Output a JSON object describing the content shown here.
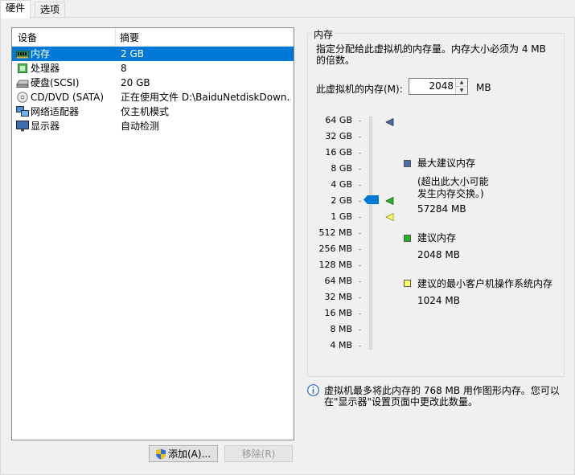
{
  "tabs": {
    "hardware": "硬件",
    "options": "选项"
  },
  "device_list": {
    "col_device": "设备",
    "col_summary": "摘要",
    "rows": [
      {
        "icon": "memory-icon",
        "name": "内存",
        "summary": "2 GB"
      },
      {
        "icon": "processor-icon",
        "name": "处理器",
        "summary": "8"
      },
      {
        "icon": "hard-disk-icon",
        "name": "硬盘(SCSI)",
        "summary": "20 GB"
      },
      {
        "icon": "cd-dvd-icon",
        "name": "CD/DVD (SATA)",
        "summary": "正在使用文件 D:\\BaiduNetdiskDown..."
      },
      {
        "icon": "network-adapter-icon",
        "name": "网络适配器",
        "summary": "仅主机模式"
      },
      {
        "icon": "display-icon",
        "name": "显示器",
        "summary": "自动检测"
      }
    ],
    "selected_index": 0
  },
  "buttons": {
    "add": "添加(A)...",
    "remove": "移除(R)"
  },
  "memory": {
    "group_title": "内存",
    "description": "指定分配给此虚拟机的内存量。内存大小必须为 4 MB 的倍数。",
    "field_label": "此虚拟机的内存(M):",
    "value": "2048",
    "unit": "MB",
    "scale": [
      "64 GB",
      "32 GB",
      "16 GB",
      "8 GB",
      "4 GB",
      "2 GB",
      "1 GB",
      "512 MB",
      "256 MB",
      "128 MB",
      "64 MB",
      "32 MB",
      "16 MB",
      "8 MB",
      "4 MB"
    ],
    "current_value_mb": 2048,
    "legend": {
      "max_title": "最大建议内存",
      "max_note": "(超出此大小可能\n发生内存交换。)",
      "max_value": "57284 MB",
      "recommended_title": "建议内存",
      "recommended_value": "2048 MB",
      "min_title": "建议的最小客户机操作系统内存",
      "min_value": "1024 MB"
    },
    "colors": {
      "max": "#4a6ea9",
      "recommended": "#23b523",
      "min": "#ffff66",
      "thumb": "#0078d7"
    }
  },
  "info": {
    "icon": "info-icon",
    "text": "虚拟机最多将此内存的 768 MB 用作图形内存。您可以在\"显示器\"设置页面中更改此数量。"
  }
}
